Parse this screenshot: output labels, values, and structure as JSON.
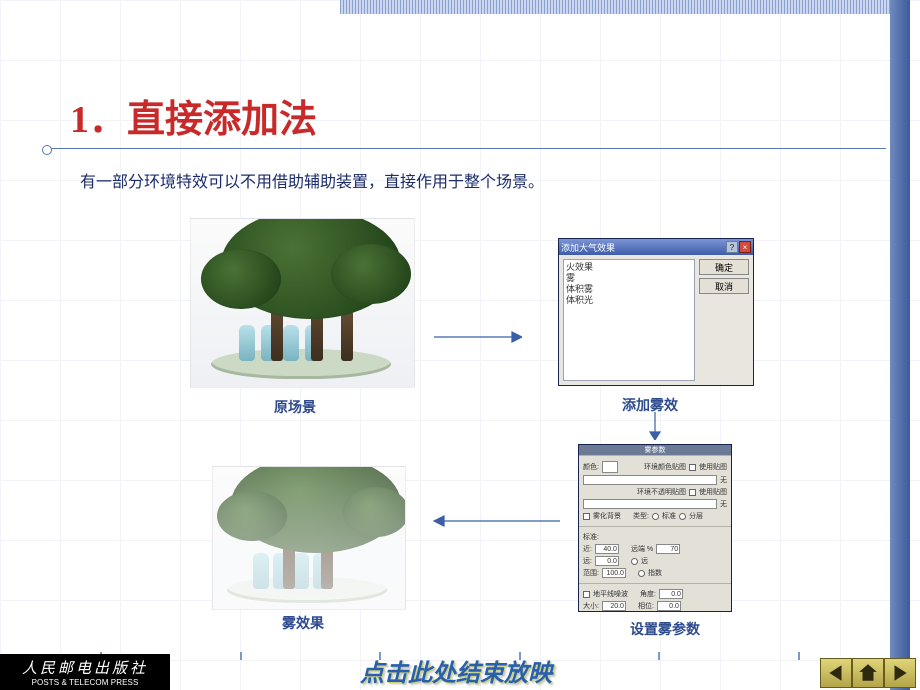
{
  "header": {
    "title": "1．直接添加法"
  },
  "description": "有一部分环境特效可以不用借助辅助装置，直接作用于整个场景。",
  "figures": {
    "original": {
      "caption": "原场景"
    },
    "addFog": {
      "caption": "添加雾效"
    },
    "fogResult": {
      "caption": "雾效果"
    },
    "setParams": {
      "caption": "设置雾参数"
    }
  },
  "dialog1": {
    "title": "添加大气效果",
    "help": "?",
    "close": "×",
    "options": [
      "火效果",
      "雾",
      "体积雾",
      "体积光"
    ],
    "ok": "确定",
    "cancel": "取消"
  },
  "panel2": {
    "bar": "雾参数",
    "colorLabel": "颜色:",
    "envColorMap": "环境颜色贴图",
    "useMap1": "使用贴图",
    "none1": "无",
    "envOpacMap": "环境不透明贴图",
    "useMap2": "使用贴图",
    "none2": "无",
    "fogBg": "雾化背景",
    "typeLabel": "类型:",
    "typeStd": "标准",
    "typeLayer": "分层",
    "stdGroup": "标准:",
    "exp": "指数",
    "nearLabel": "近:",
    "nearVal": "40.0",
    "farPctLabel": "远端 %",
    "farPctVal": "70",
    "farLabel": "远:",
    "farVal": "0.0",
    "nrLabel": "远",
    "rangeLabel": "范围:",
    "rangeVal": "100.0",
    "horizNoise": "地平线噪波",
    "angleLabel": "角度:",
    "angleVal": "0.0",
    "sizeLabel": "大小:",
    "sizeVal": "20.0",
    "phaseLabel": "相位:",
    "phaseVal": "0.0"
  },
  "footer": {
    "publisherCn": "人民邮电出版社",
    "publisherEn": "POSTS & TELECOM PRESS",
    "endText": "点击此处结束放映"
  },
  "nav": {
    "prev": "previous-slide",
    "home": "home",
    "next": "next-slide"
  }
}
